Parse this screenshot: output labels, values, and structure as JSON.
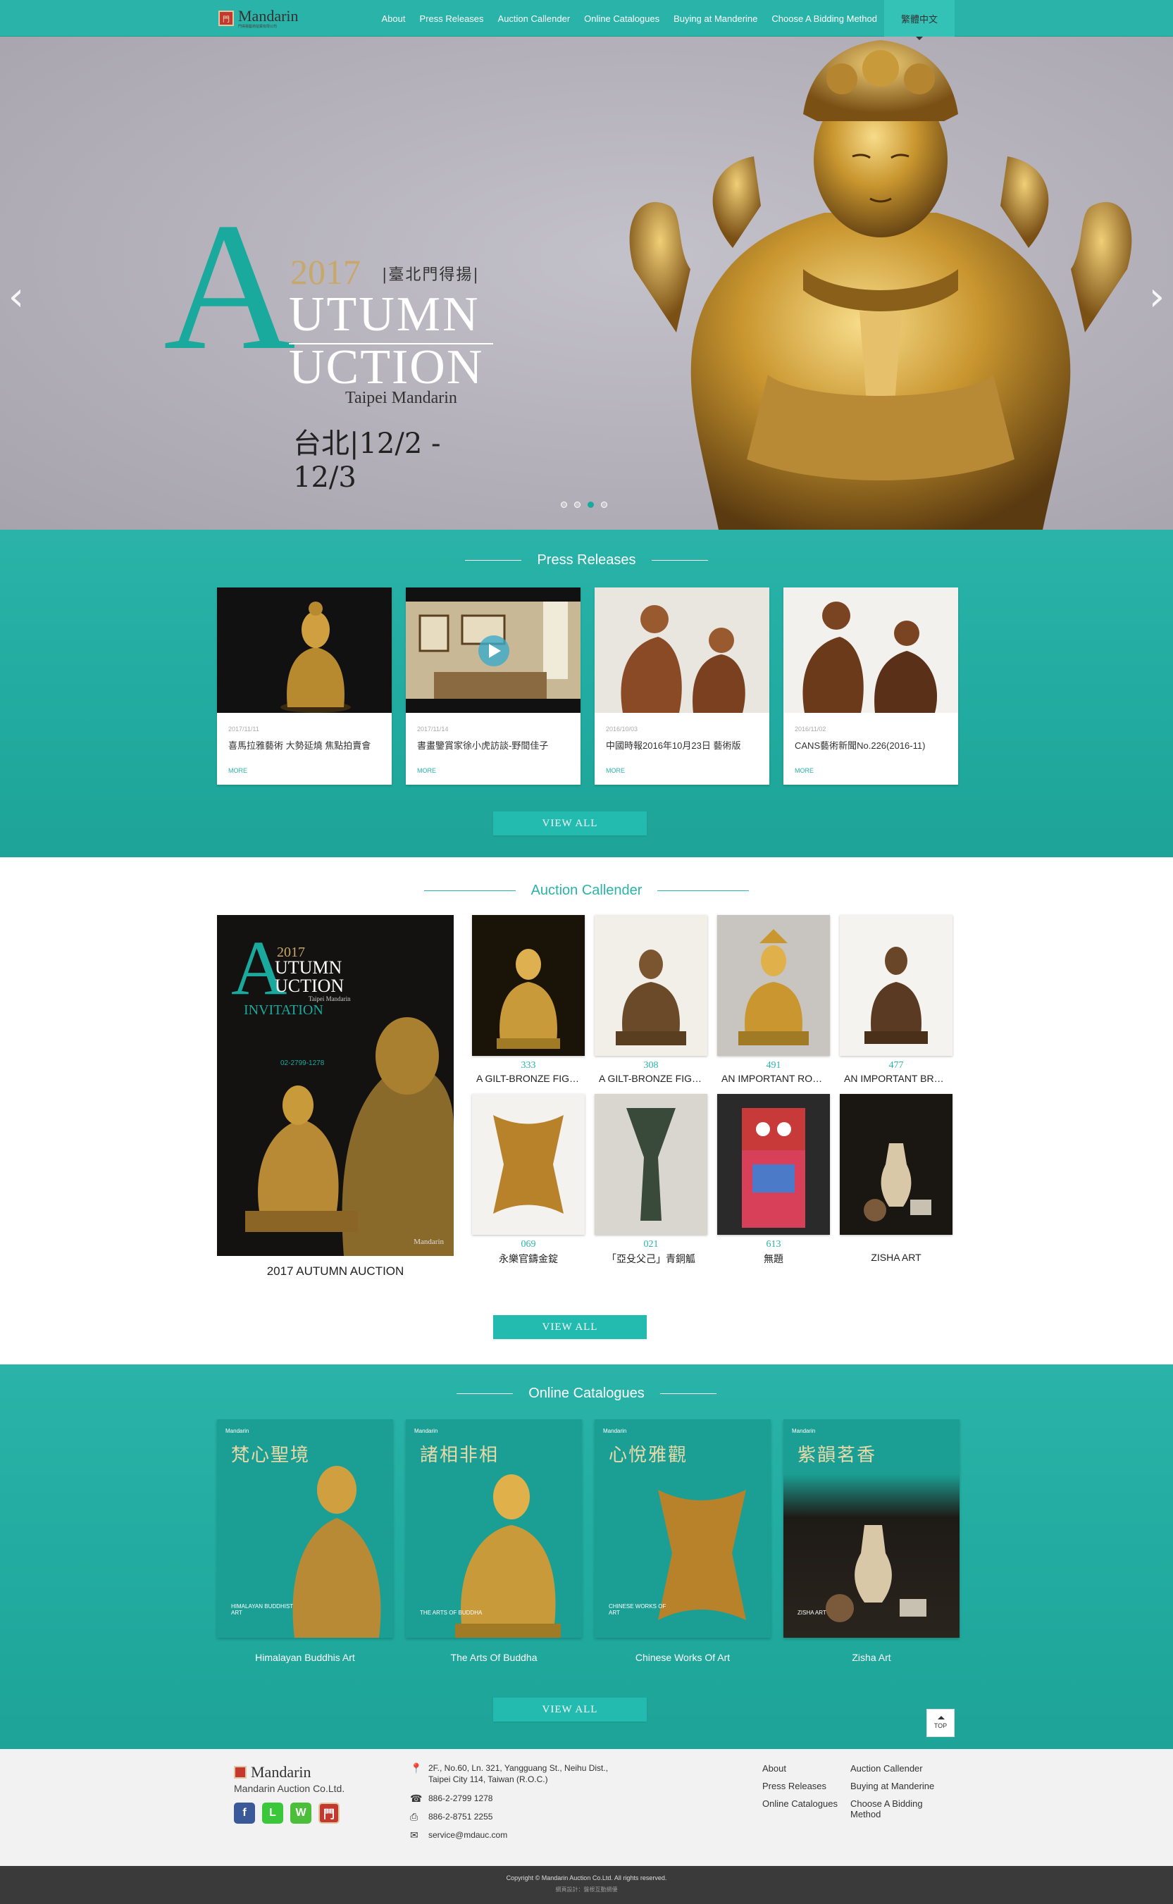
{
  "nav": {
    "logo_text": "Mandarin",
    "logo_sub": "門得揚藝術拍賣有限公司",
    "items": [
      "About",
      "Press Releases",
      "Auction Callender",
      "Online Catalogues",
      "Buying at Manderine",
      "Choose A Bidding Method"
    ],
    "lang": "繁體中文"
  },
  "hero": {
    "year": "2017",
    "zh_title": "|臺北門得揚|",
    "line1": "UTUMN",
    "line2": "UCTION",
    "big_letter": "A",
    "subtitle": "Taipei Mandarin",
    "date": "台北|12/2 - 12/3",
    "prev": "‹",
    "next": "›"
  },
  "press": {
    "title": "Press Releases",
    "cards": [
      {
        "date": "2017/11/11",
        "title": "喜馬拉雅藝術 大勢延燒 焦點拍賣會",
        "more": "MORE"
      },
      {
        "date": "2017/11/14",
        "title": "書畫鑒賞家徐小虎訪談-野間佳子",
        "more": "MORE"
      },
      {
        "date": "2016/10/03",
        "title": "中國時報2016年10月23日 藝術版",
        "more": "MORE"
      },
      {
        "date": "2016/11/02",
        "title": "CANS藝術新聞No.226(2016-11)",
        "more": "MORE"
      }
    ],
    "view_all": "VIEW ALL"
  },
  "calendar": {
    "title": "Auction Callender",
    "poster_caption": "2017 AUTUMN AUCTION",
    "poster": {
      "year": "2017",
      "l1": "UTUMN",
      "l2": "UCTION",
      "sub": "Taipei Mandarin",
      "inv": "INVITATION",
      "phone": "02-2799-1278",
      "brand": "Mandarin"
    },
    "lots": [
      {
        "num": "333",
        "caption": "A GILT-BRONZE FIGURE OF"
      },
      {
        "num": "308",
        "caption": "A GILT-BRONZE FIGURE OF"
      },
      {
        "num": "491",
        "caption": "AN IMPORTANT ROYAL GILT"
      },
      {
        "num": "477",
        "caption": "AN IMPORTANT BRONZE"
      },
      {
        "num": "069",
        "caption": "永樂官鑄金錠"
      },
      {
        "num": "021",
        "caption": "「亞殳父己」青銅觚"
      },
      {
        "num": "613",
        "caption": "無題"
      },
      {
        "num": "",
        "caption": "ZISHA ART"
      }
    ],
    "view_all": "VIEW ALL"
  },
  "catalogues": {
    "title": "Online Catalogues",
    "books": [
      {
        "cover_title": "梵心聖境",
        "cover_en": "HIMALAYAN BUDDHIST ART",
        "caption": "Himalayan Buddhis Art"
      },
      {
        "cover_title": "諸相非相",
        "cover_en": "THE ARTS OF BUDDHA",
        "caption": "The Arts Of Buddha"
      },
      {
        "cover_title": "心悅雅觀",
        "cover_en": "CHINESE WORKS OF ART",
        "caption": "Chinese Works Of Art"
      },
      {
        "cover_title": "紫韻茗香",
        "cover_en": "ZISHA ART",
        "caption": "Zisha Art"
      }
    ],
    "brand": "Mandarin",
    "view_all": "VIEW ALL",
    "top": "TOP"
  },
  "footer": {
    "name": "Mandarin",
    "company": "Mandarin Auction Co.Ltd.",
    "address": "2F., No.60, Ln. 321, Yangguang St., Neihu Dist., Taipei City 114, Taiwan (R.O.C.)",
    "tel": "886-2-2799 1278",
    "fax": "886-2-8751 2255",
    "email": "service@mdauc.com",
    "links": [
      "About",
      "Auction Callender",
      "Press Releases",
      "Buying at Manderine",
      "Online Catalogues",
      "Choose A Bidding Method"
    ],
    "copyright": "Copyright © Mandarin Auction Co.Ltd. All rights reserved.",
    "credit": "網頁設計：盤根互動網優"
  },
  "colors": {
    "teal": "#2ab3a8",
    "button": "#23bbb0",
    "footer": "#f2f2f2",
    "copyright": "#3a3a3a"
  }
}
